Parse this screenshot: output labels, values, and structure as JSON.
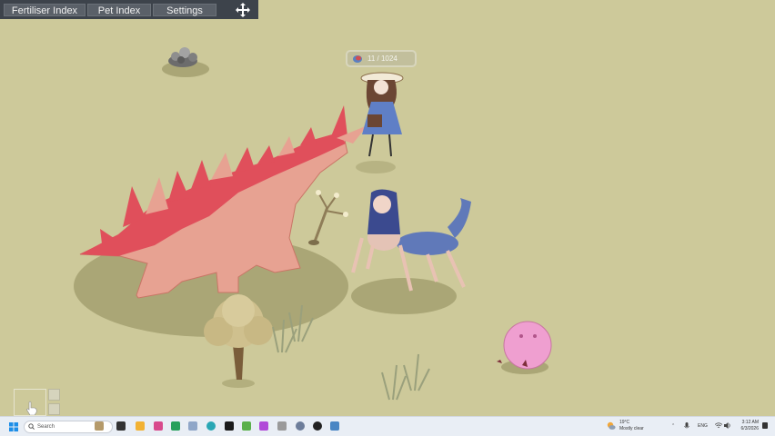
{
  "menu": {
    "items": [
      {
        "label": "Fertiliser Index"
      },
      {
        "label": "Pet Index"
      },
      {
        "label": "Settings"
      }
    ]
  },
  "counter": {
    "value": "11 / 1024",
    "icon": "seed-bag-icon"
  },
  "colors": {
    "ground": "#cdc99a",
    "dragon_body": "#e7a292",
    "dragon_spikes": "#e04f5b",
    "shadow": "#aaa676",
    "slime": "#ef9fd0",
    "menubar": "#3d434b"
  },
  "taskbar": {
    "search_placeholder": "Search",
    "weather_temp": "19°C",
    "weather_desc": "Mostly clear",
    "lang": "ENG",
    "time": "3:12 AM",
    "date": "6/3/2026"
  }
}
